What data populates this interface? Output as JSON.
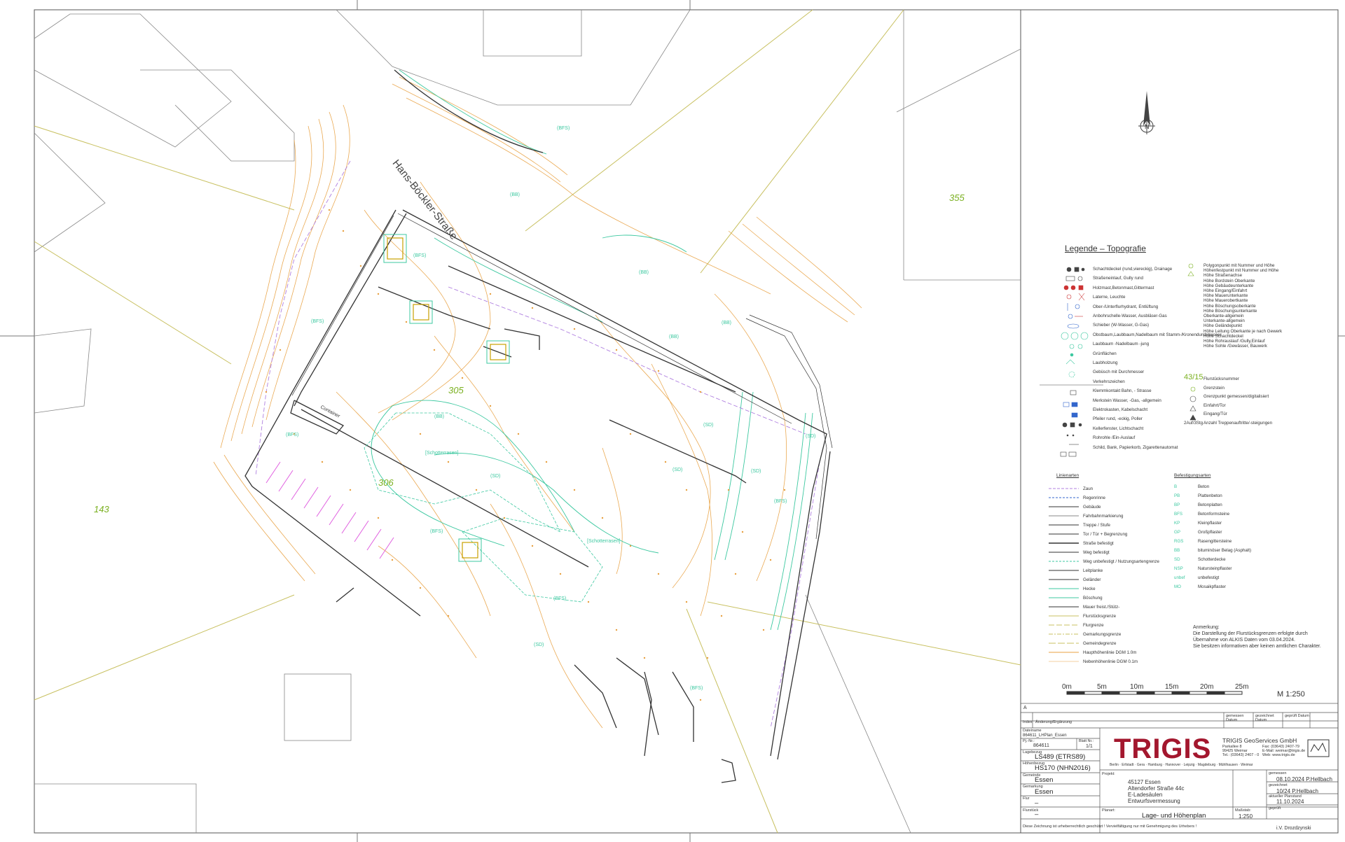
{
  "map": {
    "street_name": "Hans-Böckler-Straße",
    "parcels": [
      "355",
      "305",
      "306",
      "143"
    ],
    "areas": [
      "[Schotterrasen]",
      "[Schotterrasen]",
      "Container"
    ],
    "surface_codes": [
      "(BFS)",
      "(BFS)",
      "(BFS)",
      "(BFS)",
      "(BFS)",
      "(BFS)",
      "(BFS)",
      "(BFS)",
      "(SD)",
      "(SD)",
      "(SD)",
      "(SD)",
      "(SD)",
      "(SD)",
      "(BB)",
      "(BB)",
      "(BB)",
      "(BB)",
      "(BB)"
    ],
    "north_arrow": "N"
  },
  "legend": {
    "title": "Legende – Topografie",
    "symbols_left": [
      "Schachtdeckel (rund,viereckig), Drainage",
      "Straßeneinlauf, Gully rund",
      "Holzmast,Betonmast,Gittermast",
      "Laterne, Leuchte",
      "Ober-/Unterflurhydrant, Entlüftung",
      "Anbohrschelle-Wasser, Ausbläser-Gas",
      "Schieber (W-Wasser, G-Gas)",
      "Obstbaum,Laubbaum,Nadelbaum mit Stamm-/Kronendurchmesser",
      "Laubbaum -Nadelbaum -jung",
      "Grünflächen",
      "Laubholzung",
      "Gebüsch mit Durchmesser",
      "Verkehrszeichen",
      "Klemmkontakt Bahn, - Strasse",
      "Merkstein Wasser, -Gas, -allgemein",
      "Elektrokasten, Kabelschacht",
      "Pfeiler rund, -eckig, Poller",
      "Kellerfenster, Lichtschacht",
      "Rohrohle /Ein-Auslauf",
      "Schild, Bank, Papierkorb, Zigarettenautomat"
    ],
    "symbols_right": [
      "Polygonpunkt mit Nummer und Höhe",
      "Höhenfestpunkt mit Nummer und Höhe",
      "Höhe Straßenachse",
      "Höhe Bordstein Oberkante",
      "Höhe Gebäudeunterkante",
      "Höhe Eingang/Einfahrt",
      "Höhe Mauerunterkante",
      "Höhe Mauerobertkante",
      "Höhe Böschungsoberkante",
      "Höhe Böschungsunterkante",
      "Oberkante-allgemein",
      "Unterkante-allgemein",
      "Höhe Geländepunkt",
      "Höhe Leitung Oberkante je nach Gewerk",
      "Höhe Schachtdeckel",
      "Höhe Rohrauslauf /Gully,Einlauf",
      "Höhe Sohle /Gewässer, Bauwerk"
    ],
    "parcel_items": [
      {
        "key": "43/15",
        "label": "Flurstücksnummer"
      },
      {
        "key": "",
        "label": "Grenzstein"
      },
      {
        "key": "",
        "label": "Grenzpunkt gemessen/digitalisiert"
      },
      {
        "key": "",
        "label": "Einfahrt/Tor"
      },
      {
        "key": "",
        "label": "Eingang/Tür"
      },
      {
        "key": "2Auf/3Stg",
        "label": "Anzahl Treppenauftritte/-steigungen"
      }
    ],
    "line_types_header": "Linienarten",
    "line_types": [
      "Zaun",
      "Regenrinne",
      "Gebäude",
      "Fahrbahnmarkierung",
      "Treppe / Stufe",
      "Tor / Tür + Begrenzung",
      "Straße befestigt",
      "Weg befestigt",
      "Weg unbefestigt / Nutzungsartengrenze",
      "Leitplanke",
      "Geländer",
      "Hecke",
      "Böschung",
      "Mauer freist./Stütz-",
      "Flurstücksgrenze",
      "Flurgrenze",
      "Gemarkungsgrenze",
      "Gemeindegrenze",
      "Haupthöhenlinie DGM 1.0m",
      "Nebenhöhenlinie DGM 0.1m"
    ],
    "surface_header": "Befestigungsarten",
    "surfaces": [
      {
        "code": "B",
        "label": "Beton"
      },
      {
        "code": "PB",
        "label": "Plattenbeton"
      },
      {
        "code": "BP",
        "label": "Betonplatten"
      },
      {
        "code": "BFS",
        "label": "Betonformsteine"
      },
      {
        "code": "KP",
        "label": "Kleinpflaster"
      },
      {
        "code": "GP",
        "label": "Großpflaster"
      },
      {
        "code": "RGS",
        "label": "Rasengittersteine"
      },
      {
        "code": "BB",
        "label": "bituminöser Belag (Asphalt)"
      },
      {
        "code": "SD",
        "label": "Schotterdecke"
      },
      {
        "code": "NSP",
        "label": "Natursteinpflaster"
      },
      {
        "code": "unbef",
        "label": "unbefestigt"
      },
      {
        "code": "MO",
        "label": "Mosaikpflaster"
      }
    ],
    "note_title": "Anmerkung:",
    "note_lines": [
      "Die Darstellung der Flurstücksgrenzen erfolgte durch",
      "Übernahme von ALKIS Daten vom 03.04.2024.",
      "Sie besitzen informativen aber keinen amtlichen Charakter."
    ]
  },
  "scale_bar": {
    "ticks": [
      "0m",
      "5m",
      "10m",
      "15m",
      "20m",
      "25m"
    ],
    "ratio": "M 1:250"
  },
  "title_block": {
    "index_header": "Index",
    "change_header": "Änderung/Ergänzung",
    "gemessen": "gemessen Datum",
    "gezeichnet": "gezeichnet Datum",
    "geprueft": "geprüft Datum",
    "file_label": "Dateiname",
    "file_value": "864611_LHPlan_Essen",
    "proj_no_label": "Pj.-Nr.:",
    "proj_no": "864611",
    "blatt_label": "Blatt Nr.:",
    "blatt": "1/1",
    "lagebezug_label": "Lagebezug",
    "lagebezug": "LS489 (ETRS89)",
    "hoehenbezug_label": "Höhenbezug",
    "hoehenbezug": "HS170 (NHN2016)",
    "gemeinde_label": "Gemeinde",
    "gemeinde": "Essen",
    "gemarkung_label": "Gemarkung",
    "gemarkung": "Essen",
    "flur_label": "Flur",
    "flur": "–",
    "flurstueck_label": "Flurstück",
    "flurstueck": "–",
    "company_name": "TRIGIS GeoServices GmbH",
    "brand": "TRIGIS",
    "address": [
      "Parkallee 8",
      "99425 Weimar",
      "Tel.: (03643) 2407 - 0"
    ],
    "contact": [
      "Fax: (03643) 2407-79",
      "E-Mail: weimar@trigis.de",
      "Web: www.trigis.de"
    ],
    "offices": "Berlin · Erfstadt · Gera · Hamburg · Hannover · Leipzig · Magdeburg · Mühlhausen · Weimar",
    "project_label": "Projekt:",
    "project_lines": [
      "45127 Essen",
      "Altendorfer Straße 44c",
      "E-Ladesäulen",
      "Entwurfsvermessung"
    ],
    "plan_label": "Planart:",
    "plan": "Lage- und Höhenplan",
    "massstab_label": "Maßstab:",
    "massstab": "1:250",
    "gemessen_label": "gemessen",
    "gemessen_value": "08.10.2024 P.Hellbach",
    "gezeichnet_label": "gezeichnet",
    "gezeichnet_value": "10/24 P.Hellbach",
    "aktueller_label": "aktueller Planstand",
    "aktueller_value": "11.10.2024",
    "geprueft_label": "geprüft",
    "geprueft_value": "i.V. Drozdzynski",
    "copyright": "Diese Zeichnung ist urheberrechtlich geschützt ! Vervielfältigung nur mit Genehmigung des Urhebers !",
    "row_a": "A"
  },
  "colors": {
    "contour": "#e8a040",
    "surface": "#3cc8a0",
    "boundary": "#c8c060",
    "parcel_number": "#7ab020",
    "building": "#333333",
    "brand_red": "#a3172e"
  }
}
